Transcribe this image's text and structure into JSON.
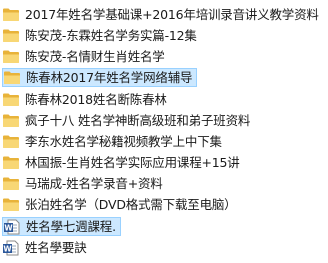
{
  "items": [
    {
      "type": "folder",
      "name": "2017年姓名学基础课+2016年培训录音讲义教学资料"
    },
    {
      "type": "folder",
      "name": "陈安茂-东霖姓名学务实篇-12集"
    },
    {
      "type": "folder",
      "name": "陈安茂-名情财生肖姓名学"
    },
    {
      "type": "folder",
      "name": "陈春林2017年姓名学网络辅导",
      "selected": true
    },
    {
      "type": "folder",
      "name": "陈春林2018姓名断陈春林"
    },
    {
      "type": "folder",
      "name": "疯子十八 姓名学神断高级班和弟子班资料"
    },
    {
      "type": "folder",
      "name": "李东水姓名学秘籍视频教学上中下集"
    },
    {
      "type": "folder",
      "name": "林国振-生肖姓名学实际应用课程+15讲"
    },
    {
      "type": "folder",
      "name": "马瑞成-姓名学录音+资料"
    },
    {
      "type": "folder",
      "name": "张泊姓名学（DVD格式需下载至电脑）"
    },
    {
      "type": "doc",
      "name": "姓名學七週課程.",
      "selected": true
    },
    {
      "type": "doc",
      "name": "姓名學要訣"
    }
  ],
  "colors": {
    "folder_back": "#e8b33a",
    "folder_front": "#f8d775",
    "doc_blue": "#2b579a",
    "selection_bg": "#cce8ff",
    "selection_border": "#99d1ff"
  }
}
